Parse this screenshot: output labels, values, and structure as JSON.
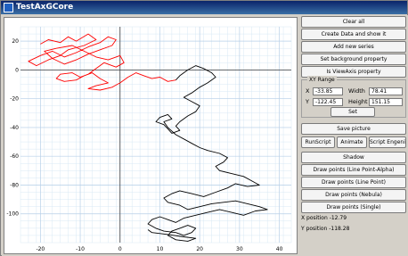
{
  "window": {
    "title": "TestAxGCore"
  },
  "buttons": {
    "clear_all": "Clear all",
    "create_data": "Create Data and show it",
    "add_series": "Add new series",
    "set_bg": "Set background property",
    "is_viewaxis": "Is ViewAxis property",
    "save_picture": "Save picture",
    "run_script": "RunScript",
    "animate": "Animate",
    "script_engine": "Script Engenie",
    "shadow": "Shadow",
    "draw_line_point_alpha": "Draw points (Line Point-Alpha)",
    "draw_line_point": "Draw points (Line Point)",
    "draw_nebula": "Draw points (Nebula)",
    "draw_single": "Draw points (Single)"
  },
  "xy_range": {
    "title": "XY Range",
    "x_label": "X",
    "y_label": "Y",
    "width_label": "Width",
    "height_label": "Height",
    "x_value": "-33.85",
    "y_value": "-122.45",
    "width_value": "78.41",
    "height_value": "151.15",
    "set_label": "Set"
  },
  "status": {
    "x_position": "X position -12.79",
    "y_position": "Y position -118.28"
  },
  "colors": {
    "series_red": "#ff0000",
    "series_black": "#000000",
    "grid": "#d8e8f4",
    "axis": "#404040"
  },
  "chart_data": {
    "type": "line",
    "title": "",
    "xlabel": "",
    "ylabel": "",
    "xlim": [
      -25,
      43
    ],
    "ylim": [
      -120,
      30
    ],
    "x_ticks": [
      -20,
      -10,
      0,
      10,
      20,
      30,
      40
    ],
    "y_ticks": [
      20,
      0,
      -20,
      -40,
      -60,
      -80,
      -100
    ],
    "grid": true,
    "series": [
      {
        "color": "#ff0000",
        "points": [
          [
            -20,
            18
          ],
          [
            -18,
            21
          ],
          [
            -15,
            19
          ],
          [
            -13,
            23
          ],
          [
            -11,
            20
          ],
          [
            -8,
            25
          ],
          [
            -6,
            21
          ],
          [
            -9,
            17
          ],
          [
            -13,
            14
          ],
          [
            -15,
            10
          ],
          [
            -18,
            7
          ],
          [
            -21,
            3
          ],
          [
            -23,
            6
          ],
          [
            -20,
            10
          ],
          [
            -17,
            13
          ],
          [
            -14,
            9
          ],
          [
            -11,
            12
          ],
          [
            -8,
            16
          ],
          [
            -5,
            19
          ],
          [
            -3,
            23
          ],
          [
            -1,
            21
          ],
          [
            -2,
            17
          ],
          [
            -5,
            14
          ],
          [
            -8,
            11
          ],
          [
            -11,
            7
          ],
          [
            -14,
            4
          ],
          [
            -17,
            8
          ],
          [
            -19,
            13
          ],
          [
            -16,
            15
          ],
          [
            -12,
            17
          ],
          [
            -9,
            13
          ],
          [
            -6,
            9
          ],
          [
            -3,
            7
          ],
          [
            0,
            10
          ],
          [
            1,
            5
          ],
          [
            -1,
            2
          ],
          [
            -4,
            5
          ],
          [
            -6,
            1
          ],
          [
            -8,
            -3
          ],
          [
            -10,
            -5
          ],
          [
            -12,
            -2
          ],
          [
            -15,
            -3
          ],
          [
            -16,
            -6
          ],
          [
            -14,
            -8
          ],
          [
            -11,
            -7
          ],
          [
            -9,
            -4
          ],
          [
            -7,
            -2
          ],
          [
            -5,
            -6
          ],
          [
            -3,
            -9
          ],
          [
            -6,
            -11
          ],
          [
            -8,
            -13
          ],
          [
            -5,
            -14
          ],
          [
            -2,
            -12
          ],
          [
            0,
            -9
          ],
          [
            2,
            -5
          ],
          [
            4,
            -2
          ],
          [
            6,
            -4
          ],
          [
            8,
            -6
          ],
          [
            10,
            -5
          ],
          [
            12,
            -8
          ],
          [
            14,
            -7
          ]
        ]
      },
      {
        "color": "#000000",
        "points": [
          [
            14,
            -7
          ],
          [
            15,
            -4
          ],
          [
            17,
            0
          ],
          [
            19,
            3
          ],
          [
            21,
            1
          ],
          [
            23,
            -2
          ],
          [
            24,
            -5
          ],
          [
            22,
            -9
          ],
          [
            20,
            -12
          ],
          [
            18,
            -16
          ],
          [
            16,
            -19
          ],
          [
            18,
            -22
          ],
          [
            20,
            -25
          ],
          [
            19,
            -29
          ],
          [
            17,
            -32
          ],
          [
            15,
            -36
          ],
          [
            14,
            -39
          ],
          [
            15,
            -42
          ],
          [
            13,
            -44
          ],
          [
            12,
            -41
          ],
          [
            11,
            -38
          ],
          [
            9,
            -36
          ],
          [
            10,
            -33
          ],
          [
            12,
            -31
          ],
          [
            13,
            -34
          ],
          [
            11,
            -36
          ],
          [
            12,
            -40
          ],
          [
            14,
            -45
          ],
          [
            16,
            -48
          ],
          [
            18,
            -51
          ],
          [
            20,
            -54
          ],
          [
            22,
            -56
          ],
          [
            25,
            -58
          ],
          [
            27,
            -61
          ],
          [
            26,
            -64
          ],
          [
            24,
            -67
          ],
          [
            25,
            -70
          ],
          [
            28,
            -72
          ],
          [
            31,
            -74
          ],
          [
            33,
            -77
          ],
          [
            35,
            -80
          ],
          [
            32,
            -81
          ],
          [
            29,
            -79
          ],
          [
            27,
            -82
          ],
          [
            24,
            -85
          ],
          [
            21,
            -88
          ],
          [
            18,
            -86
          ],
          [
            15,
            -84
          ],
          [
            13,
            -86
          ],
          [
            11,
            -89
          ],
          [
            12,
            -92
          ],
          [
            15,
            -94
          ],
          [
            17,
            -97
          ],
          [
            20,
            -95
          ],
          [
            23,
            -93
          ],
          [
            26,
            -92
          ],
          [
            29,
            -91
          ],
          [
            32,
            -93
          ],
          [
            35,
            -95
          ],
          [
            37,
            -97
          ],
          [
            34,
            -98
          ],
          [
            31,
            -101
          ],
          [
            28,
            -99
          ],
          [
            25,
            -97
          ],
          [
            22,
            -99
          ],
          [
            19,
            -101
          ],
          [
            16,
            -103
          ],
          [
            14,
            -106
          ],
          [
            12,
            -104
          ],
          [
            10,
            -102
          ],
          [
            8,
            -104
          ],
          [
            7,
            -107
          ],
          [
            9,
            -110
          ],
          [
            11,
            -112
          ],
          [
            14,
            -113
          ],
          [
            16,
            -115
          ],
          [
            18,
            -113
          ],
          [
            19,
            -110
          ],
          [
            17,
            -108
          ],
          [
            15,
            -110
          ],
          [
            13,
            -112
          ],
          [
            12,
            -115
          ],
          [
            14,
            -118
          ],
          [
            17,
            -119
          ],
          [
            19,
            -117
          ],
          [
            16,
            -116
          ],
          [
            11,
            -114
          ],
          [
            8,
            -113
          ],
          [
            7,
            -111
          ]
        ]
      }
    ]
  }
}
